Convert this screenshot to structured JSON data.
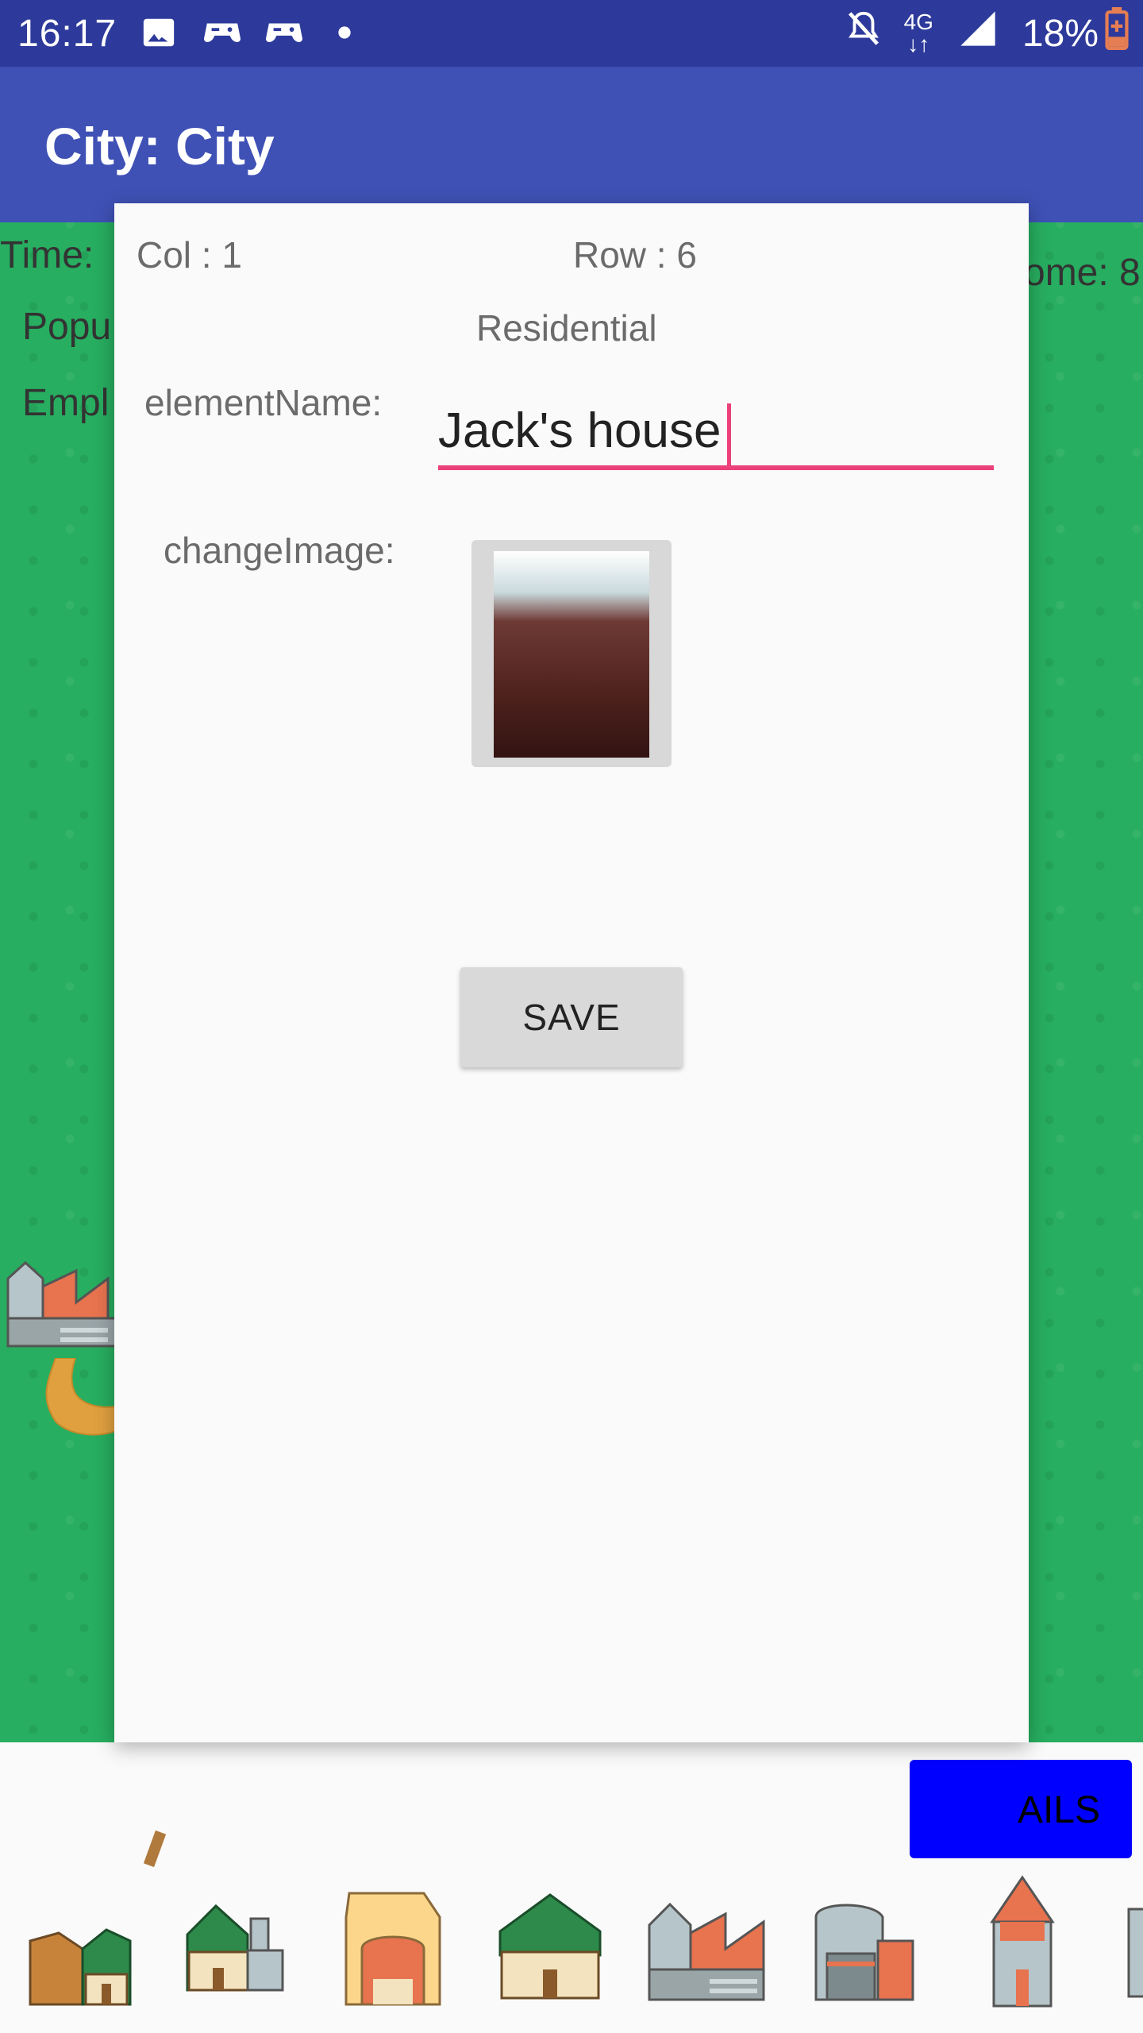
{
  "status_bar": {
    "time": "16:17",
    "network": "4G",
    "battery_pct": "18%",
    "icons": [
      "image-icon",
      "game-controller-icon",
      "game-controller-icon",
      "notification-dot-icon",
      "bell-off-icon",
      "network-4g-icon",
      "signal-icon",
      "battery-icon"
    ]
  },
  "app_bar": {
    "title": "City: City"
  },
  "map": {
    "time_label": "Time:",
    "income_label": "ome: 8",
    "population_label": "Popu",
    "employment_label": "Empl"
  },
  "dialog": {
    "col_label": "Col : 1",
    "row_label": "Row : 6",
    "zone_type": "Residential",
    "element_name_label": "elementName:",
    "element_name_value": "Jack's house",
    "change_image_label": "changeImage:",
    "save_label": "SAVE"
  },
  "bottom": {
    "details_label": "AILS",
    "toolbar_items": [
      "barn-icon",
      "house-factory-icon",
      "shop-icon",
      "house-icon",
      "factory-icon",
      "garage-icon",
      "tower-icon",
      "building-icon"
    ]
  },
  "colors": {
    "status_bar": "#2d3a9b",
    "app_bar": "#3f51b5",
    "map_green": "#27ae60",
    "accent_pink": "#ec407a",
    "details_blue": "#0000ff"
  }
}
